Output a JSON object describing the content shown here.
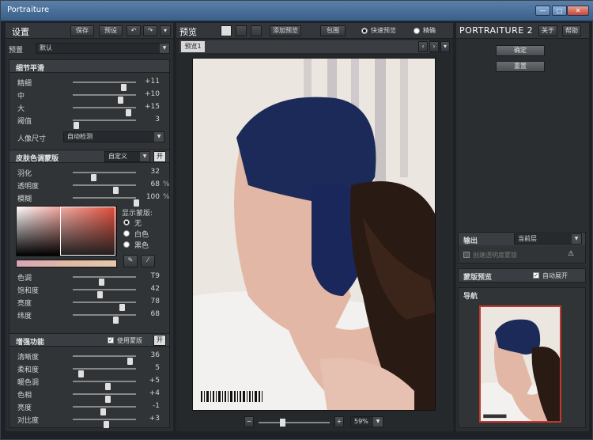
{
  "window": {
    "title": "Portraiture",
    "min": "—",
    "max": "□",
    "close": "✕"
  },
  "left": {
    "title": "设置",
    "save": "保存",
    "preset_btn": "预设",
    "undo": "↶",
    "redo": "↷",
    "menu": "▾",
    "preset_label": "预置",
    "preset_value": "默认",
    "detail": {
      "title": "细节平滑",
      "rows": [
        {
          "label": "精细",
          "value": "+11",
          "level": 0.8
        },
        {
          "label": "中",
          "value": "+10",
          "level": 0.75
        },
        {
          "label": "大",
          "value": "+15",
          "level": 0.88
        },
        {
          "label": "阈值",
          "value": "3",
          "level": 0.05
        }
      ],
      "portrait_size_label": "人像尺寸",
      "portrait_size_value": "自动检测"
    },
    "skin": {
      "title": "皮肤色调蒙版",
      "mode": "自定义",
      "toggle": "开",
      "rows": [
        {
          "label": "羽化",
          "value": "32",
          "level": 0.32
        },
        {
          "label": "透明度",
          "value": "68",
          "unit": "%",
          "level": 0.68
        },
        {
          "label": "模糊",
          "value": "100",
          "unit": "%",
          "level": 1.0
        }
      ],
      "show_mask_label": "显示蒙版:",
      "options": [
        "无",
        "白色",
        "黑色"
      ],
      "rows2": [
        {
          "label": "色调",
          "value": "T9",
          "level": 0.45
        },
        {
          "label": "饱和度",
          "value": "42",
          "level": 0.42
        },
        {
          "label": "亮度",
          "value": "78",
          "level": 0.78
        },
        {
          "label": "纬度",
          "value": "68",
          "level": 0.68
        }
      ]
    },
    "enhance": {
      "title": "增强功能",
      "use_mask": "使用蒙版",
      "toggle": "开",
      "rows": [
        {
          "label": "清晰度",
          "value": "36",
          "level": 0.9
        },
        {
          "label": "柔和度",
          "value": "5",
          "level": 0.12
        },
        {
          "label": "暖色调",
          "value": "+5",
          "level": 0.55
        },
        {
          "label": "色相",
          "value": "+4",
          "level": 0.55
        },
        {
          "label": "亮度",
          "value": "-1",
          "level": 0.48
        },
        {
          "label": "对比度",
          "value": "+3",
          "level": 0.53
        }
      ]
    }
  },
  "center": {
    "title": "预览",
    "add_preview": "添加预览",
    "crop": "包围",
    "quick_preview": "快速预览",
    "accurate": "精确",
    "tab": "预览1",
    "zoom_minus": "−",
    "zoom_plus": "+",
    "zoom_value": "59%",
    "zoom_level": 0.3
  },
  "right": {
    "logo": "PORTRAITURE 2",
    "about": "关于",
    "help": "帮助",
    "ok": "确定",
    "reset": "重置",
    "output": {
      "title": "输出",
      "layer": "当前层",
      "new_layer": "创建透明度蒙版",
      "warn": "⚠"
    },
    "mask_preview": {
      "title": "蒙版预览",
      "auto": "自动展开"
    },
    "nav_title": "导航"
  },
  "colors": {
    "accent": "#c0392b",
    "panel": "#2b2e31",
    "titlebar": "#4a6f98"
  }
}
